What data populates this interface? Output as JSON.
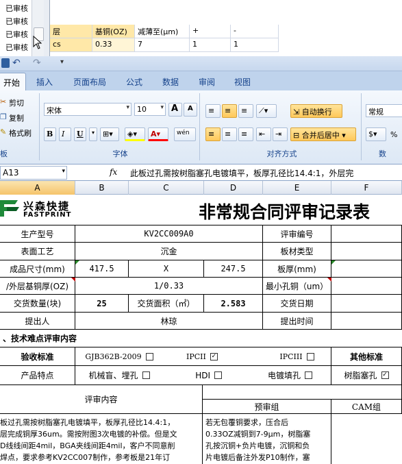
{
  "background_window": {
    "left_items": [
      "已审核",
      "已审核",
      "已审核",
      "已审核"
    ],
    "table": {
      "headers": [
        "层",
        "基铜(OZ)",
        "减薄至(μm)",
        "+",
        "-"
      ],
      "row": [
        "cs",
        "0.33",
        "7",
        "1",
        "1"
      ]
    }
  },
  "quick_access": {
    "undo": "↶",
    "redo": "↷"
  },
  "tabs": [
    "开始",
    "插入",
    "页面布局",
    "公式",
    "数据",
    "审阅",
    "视图"
  ],
  "ribbon": {
    "clipboard": {
      "label": "板",
      "cut": "剪切",
      "copy": "复制",
      "format_painter": "格式刷"
    },
    "font": {
      "label": "字体",
      "family": "宋体",
      "size": "10",
      "grow": "A",
      "shrink": "A",
      "bold": "B",
      "italic": "I",
      "underline": "U",
      "phonetic": "wén",
      "font_color_letter": "A"
    },
    "alignment": {
      "label": "对齐方式",
      "wrap": "自动换行",
      "merge": "合并后居中"
    },
    "number": {
      "label": "数",
      "format": "常规",
      "percent": "%"
    }
  },
  "formula_bar": {
    "name_box": "A13",
    "fx": "fx",
    "content": "此板过孔需按树脂塞孔电镀填平，板厚孔径比14.4:1，外层完"
  },
  "columns": [
    "A",
    "B",
    "C",
    "D",
    "E",
    "F"
  ],
  "sheet": {
    "logo_cn": "兴森快捷",
    "logo_en": "FASTPRINT",
    "title": "非常规合同评审记录表",
    "rows": {
      "model_label": "生产型号",
      "model_value": "KV2CC009A0",
      "review_no_label": "评审编号",
      "surface_label": "表面工艺",
      "surface_value": "沉金",
      "material_label": "板材类型",
      "size_label": "成品尺寸(mm)",
      "size_w": "417.5",
      "size_x": "X",
      "size_h": "247.5",
      "thickness_label": "板厚(mm)",
      "copper_label": "/外层基铜厚(OZ)",
      "copper_value": "1/0.33",
      "min_hole_label": "最小孔铜（um）",
      "qty_label": "交货数量(块)",
      "qty_value": "25",
      "area_label": "交货面积（㎡）",
      "area_value": "2.583",
      "date_label": "交货日期",
      "proposer_label": "提出人",
      "proposer_value": "林琼",
      "time_label": "提出时间"
    },
    "section_title": "、技术难点评审内容",
    "acceptance_label": "验收标准",
    "standards": [
      {
        "name": "GJB362B-2009",
        "checked": false,
        "mark": ""
      },
      {
        "name": "IPCII",
        "checked": true,
        "mark": "✓"
      },
      {
        "name": "IPCIII",
        "checked": false,
        "mark": ""
      }
    ],
    "other_standard": "其他标准",
    "features_label": "产品特点",
    "features": [
      {
        "name": "机械盲、埋孔",
        "checked": false,
        "mark": ""
      },
      {
        "name": "HDI",
        "checked": false,
        "mark": ""
      },
      {
        "name": "电镀填孔",
        "checked": false,
        "mark": ""
      },
      {
        "name": "树脂塞孔",
        "checked": true,
        "mark": "✓"
      }
    ],
    "review_content_label": "评审内容",
    "pre_review_label": "预审组",
    "cam_label": "CAM组",
    "review_text": [
      "板过孔需按树脂塞孔电镀填平，板厚孔径比14.4:1，",
      "层完成铜厚36um。需按附图3次电镀的补偿。但是文",
      "D线线间距4mil，BGA夹线间距4mil，客户不同意削",
      "焊点，要求参考KV2CC007制作，参考板是21年订"
    ],
    "pre_review_text": [
      "若无包覆铜要求，压合后",
      "0.33OZ减铜到7-9μm，树脂塞",
      "孔按沉铜+负片电镀，沉铜和负",
      "片电镀后备注外发P10制作，塞"
    ]
  }
}
